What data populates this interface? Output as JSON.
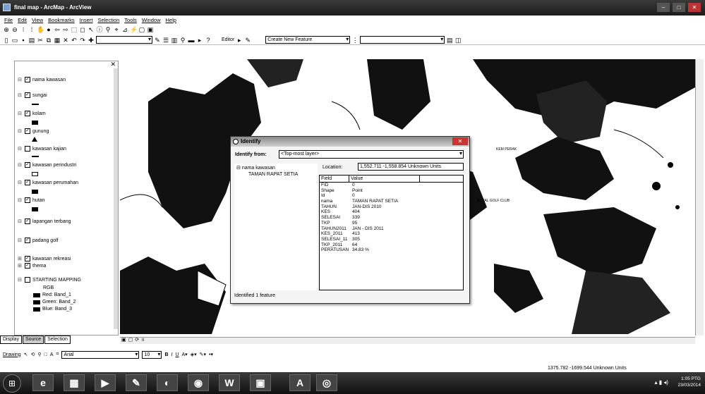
{
  "window": {
    "title": "final map - ArcMap - ArcView"
  },
  "menu": [
    "File",
    "Edit",
    "View",
    "Bookmarks",
    "Insert",
    "Selection",
    "Tools",
    "Window",
    "Help"
  ],
  "toolbar": {
    "editor_label": "Editor",
    "task_combo": "Create New Feature"
  },
  "toc": {
    "layers": [
      {
        "name": "nama kawasan",
        "checked": true,
        "symbol": "none"
      },
      {
        "name": "sungai",
        "checked": true,
        "symbol": "line"
      },
      {
        "name": "kolam",
        "checked": true,
        "symbol": "box"
      },
      {
        "name": "gunung",
        "checked": true,
        "symbol": "triangle"
      },
      {
        "name": "kawasan kajian",
        "checked": false,
        "symbol": "box"
      },
      {
        "name": "kawasan perindustri",
        "checked": true,
        "symbol": "hollow"
      },
      {
        "name": "kawasan perumahan",
        "checked": true,
        "symbol": "box"
      },
      {
        "name": "hutan",
        "checked": true,
        "symbol": "box"
      },
      {
        "name": "lapangan terbang",
        "checked": true,
        "symbol": "none"
      },
      {
        "name": "padang golf",
        "checked": true,
        "symbol": "none"
      },
      {
        "name": "kawasan rekreasi",
        "checked": true,
        "symbol": "none"
      },
      {
        "name": "thema",
        "checked": true,
        "symbol": "none"
      },
      {
        "name": "STARTING MAPPING",
        "checked": false,
        "symbol": "none"
      }
    ],
    "rgb_label": "RGB",
    "bands": [
      "Red:   Band_1",
      "Green: Band_2",
      "Blue:  Band_3"
    ],
    "tabs": [
      "Display",
      "Source",
      "Selection"
    ]
  },
  "identify": {
    "title": "Identify",
    "identify_from_label": "Identify from:",
    "identify_from_value": "<Top-most layer>",
    "tree_layer": "nama kawasan",
    "tree_feature": "TAMAN RAPAT SETIA",
    "location_label": "Location:",
    "location_value": "1,552.711  -1,558.854 Unknown Units",
    "columns": [
      "Field",
      "Value"
    ],
    "rows": [
      {
        "field": "FID",
        "value": "0"
      },
      {
        "field": "Shape",
        "value": "Point"
      },
      {
        "field": "Id",
        "value": "0"
      },
      {
        "field": "nama",
        "value": "TAMAN RAPAT SETIA"
      },
      {
        "field": "TAHUN",
        "value": "JAN-DIS 2010"
      },
      {
        "field": "KES",
        "value": "404"
      },
      {
        "field": "SELESAI",
        "value": "339"
      },
      {
        "field": "TKP",
        "value": "95"
      },
      {
        "field": "TAHUN2011",
        "value": "JAN - DIS 2011"
      },
      {
        "field": "KES_2011",
        "value": "413"
      },
      {
        "field": "SELESAI_11",
        "value": "305"
      },
      {
        "field": "TKP_2011",
        "value": "64"
      },
      {
        "field": "PERATUSAN",
        "value": "34.83 %"
      }
    ],
    "status": "Identified 1 feature"
  },
  "map_labels": {
    "label_a": "KEM PERAK",
    "label_b": "ROYAL GOLF CLUB"
  },
  "drawing": {
    "drawing_label": "Drawing",
    "font": "Arial",
    "size": "10"
  },
  "status": {
    "coords": "1375.782  -1699.544 Unknown Units"
  },
  "clock": {
    "time": "1:05 PTG",
    "date": "23/03/2014"
  }
}
